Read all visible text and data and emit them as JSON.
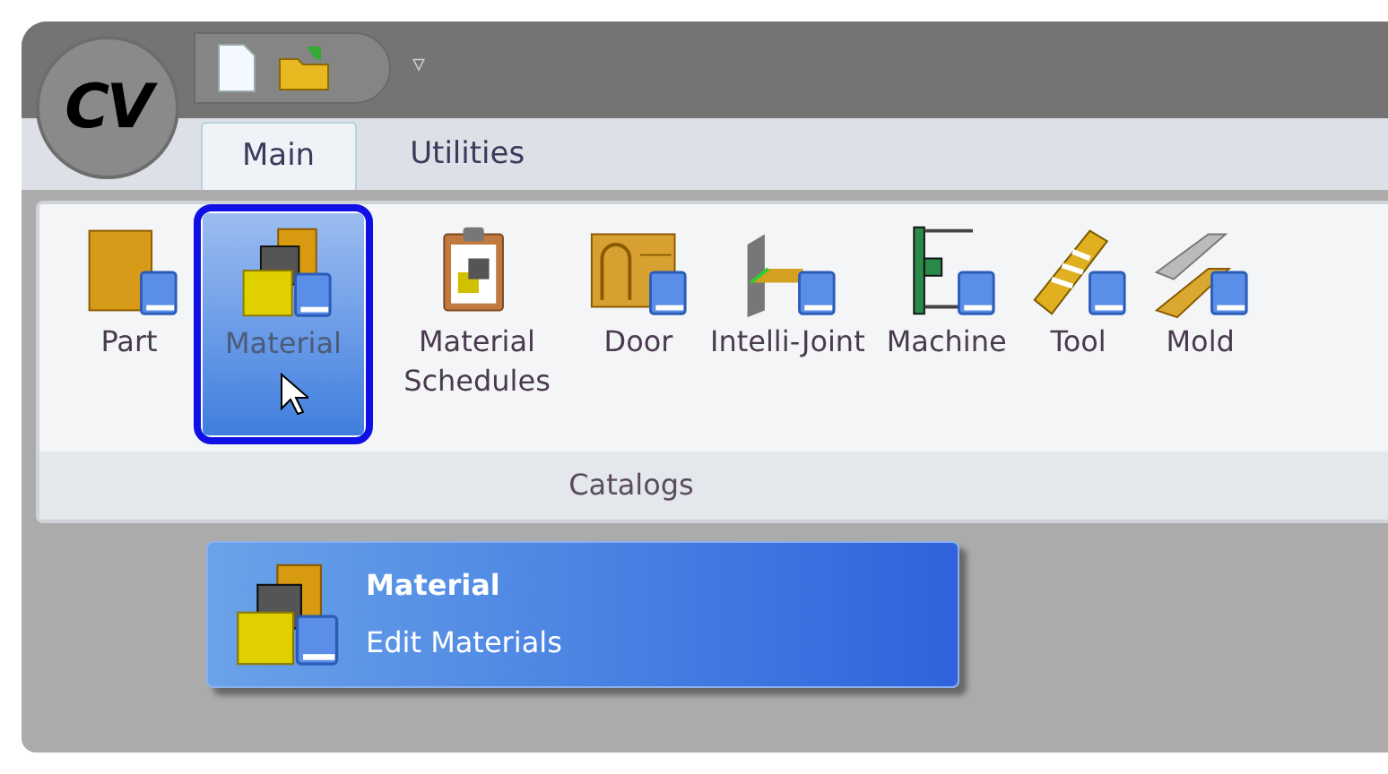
{
  "quick_access": {
    "menu_glyph": "▿"
  },
  "logo": {
    "text": "CV"
  },
  "tabs": [
    {
      "label": "Main",
      "selected": true
    },
    {
      "label": "Utilities",
      "selected": false
    }
  ],
  "ribbon": {
    "group_label": "Catalogs",
    "buttons": [
      {
        "kind": "part",
        "label": "Part",
        "selected": false
      },
      {
        "kind": "material",
        "label": "Material",
        "selected": true
      },
      {
        "kind": "schedule",
        "label": "Material Schedules",
        "selected": false
      },
      {
        "kind": "door",
        "label": "Door",
        "selected": false
      },
      {
        "kind": "joint",
        "label": "Intelli-Joint",
        "selected": false
      },
      {
        "kind": "machine",
        "label": "Machine",
        "selected": false
      },
      {
        "kind": "tool",
        "label": "Tool",
        "selected": false
      },
      {
        "kind": "mold",
        "label": "Mold",
        "selected": false
      }
    ]
  },
  "tooltip": {
    "title": "Material",
    "description": "Edit Materials"
  }
}
